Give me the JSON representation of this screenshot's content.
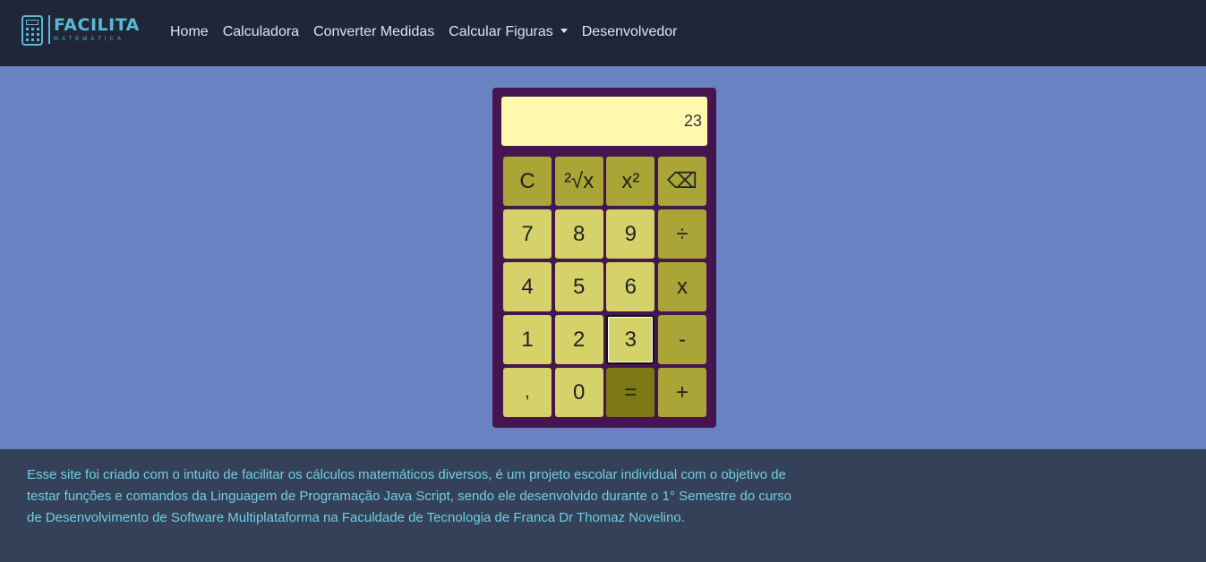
{
  "brand": {
    "name": "FACILITA",
    "subtitle": "MATEMÁTICA"
  },
  "nav": {
    "items": [
      {
        "label": "Home"
      },
      {
        "label": "Calculadora"
      },
      {
        "label": "Converter Medidas"
      },
      {
        "label": "Calcular Figuras"
      },
      {
        "label": "Desenvolvedor"
      }
    ]
  },
  "calculator": {
    "display_value": "23",
    "keys": [
      {
        "label": "C",
        "name": "clear-button",
        "style": "dark"
      },
      {
        "label": "²√x",
        "name": "square-root-button",
        "style": "dark"
      },
      {
        "label": "x²",
        "name": "square-button",
        "style": "dark"
      },
      {
        "label": "⌫",
        "name": "backspace-button",
        "style": "dark"
      },
      {
        "label": "7",
        "name": "digit-7-button",
        "style": "light"
      },
      {
        "label": "8",
        "name": "digit-8-button",
        "style": "light"
      },
      {
        "label": "9",
        "name": "digit-9-button",
        "style": "light"
      },
      {
        "label": "÷",
        "name": "divide-button",
        "style": "dark"
      },
      {
        "label": "4",
        "name": "digit-4-button",
        "style": "light"
      },
      {
        "label": "5",
        "name": "digit-5-button",
        "style": "light"
      },
      {
        "label": "6",
        "name": "digit-6-button",
        "style": "light"
      },
      {
        "label": "x",
        "name": "multiply-button",
        "style": "dark"
      },
      {
        "label": "1",
        "name": "digit-1-button",
        "style": "light"
      },
      {
        "label": "2",
        "name": "digit-2-button",
        "style": "light"
      },
      {
        "label": "3",
        "name": "digit-3-button",
        "style": "light"
      },
      {
        "label": "-",
        "name": "subtract-button",
        "style": "dark"
      },
      {
        "label": ",",
        "name": "decimal-button",
        "style": "light"
      },
      {
        "label": "0",
        "name": "digit-0-button",
        "style": "light"
      },
      {
        "label": "=",
        "name": "equals-button",
        "style": "darker"
      },
      {
        "label": "+",
        "name": "add-button",
        "style": "dark"
      }
    ]
  },
  "footer": {
    "text": "Esse site foi criado com o intuito de facilitar os cálculos matemáticos diversos, é um projeto escolar individual com o objetivo de testar funções e comandos da Linguagem de Programação Java Script, sendo ele desenvolvido durante o 1° Semestre do curso de Desenvolvimento de Software Multiplataforma na Faculdade de Tecnologia de Franca Dr Thomaz Novelino."
  },
  "colors": {
    "page_bg": "#6882c2",
    "navbar_bg": "#1f2637",
    "brand_accent": "#5ab8d4",
    "calculator_bg": "#44154f",
    "display_bg": "#fff8ad",
    "key_light": "#d5d26a",
    "key_dark": "#a9a536",
    "key_equals": "#7d7914",
    "footer_bg": "#354059",
    "footer_text": "#6fd0e3"
  }
}
